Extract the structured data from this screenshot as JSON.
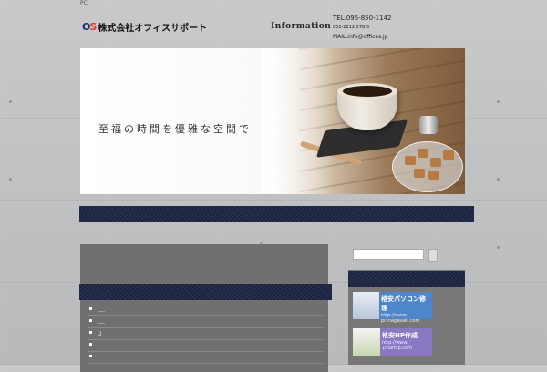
{
  "header": {
    "pc_label": "PC",
    "logo_mark_o": "O",
    "logo_mark_s": "S",
    "company_name": "株式会社オフィスサポート",
    "info_heading": "Information",
    "tel": "TEL.095-850-1142",
    "fax": "851-2212 278-5",
    "mail": "MAIL.info@offices.jp"
  },
  "hero": {
    "catchphrase": "至福の時間を優雅な空間で"
  },
  "main": {
    "news_items": [
      {
        "text": "＿"
      },
      {
        "text": "＿"
      },
      {
        "text": "」"
      },
      {
        "text": ""
      },
      {
        "text": ""
      }
    ]
  },
  "sidebar": {
    "search_placeholder": "",
    "banners": [
      {
        "title": "格安パソコン修理",
        "url_line1": "http://www.",
        "url_line2": "pc-nagasaki.com"
      },
      {
        "title": "格安HP作成",
        "url_line1": "http://www.",
        "url_line2": "1manhp.com"
      }
    ]
  },
  "colors": {
    "denim": "#1e2747",
    "banner_blue": "#4f86c9",
    "banner_purple": "#8a78c2",
    "logo_navy": "#1b2a6b",
    "logo_red": "#e03a2b"
  }
}
